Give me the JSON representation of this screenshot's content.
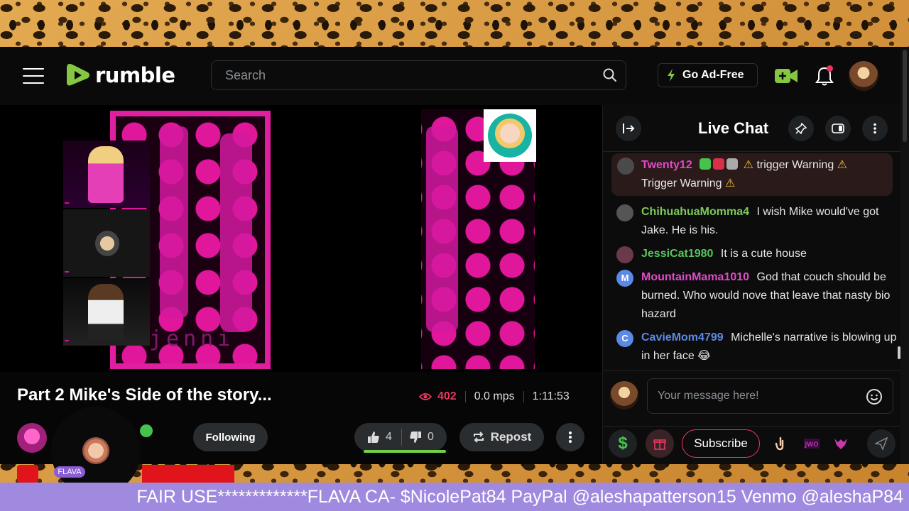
{
  "header": {
    "logo_text": "rumble",
    "search_placeholder": "Search",
    "ad_free_label": "Go Ad-Free"
  },
  "video": {
    "title": "Part 2 Mike's Side of the story...",
    "views": "402",
    "mps": "0.0 mps",
    "duration": "1:11:53",
    "following_label": "Following",
    "likes": "4",
    "dislikes": "0",
    "repost_label": "Repost",
    "watermark": "jenni"
  },
  "chat": {
    "title": "Live Chat",
    "messages": [
      {
        "user": "Twenty12",
        "color": "#e14bc8",
        "text": "trigger Warning",
        "text2": "Trigger Warning",
        "highlight": true
      },
      {
        "user": "ChihuahuaMomma4",
        "color": "#7cc95b",
        "text": "I wish Mike would've got Jake. He is his."
      },
      {
        "user": "JessiCat1980",
        "color": "#55c65a",
        "text": "It is a cute house"
      },
      {
        "user": "MountainMama1010",
        "color": "#e14bc8",
        "initial": "M",
        "text": "God that couch should be burned. Who would nove that leave that nasty bio hazard"
      },
      {
        "user": "CavieMom4799",
        "color": "#5b8ae6",
        "initial": "C",
        "text": "Michelle's narrative is blowing up in her face 😂"
      }
    ],
    "compose_placeholder": "Your message here!",
    "dollar_label": "$",
    "subscribe_label": "Subscribe"
  },
  "overlay": {
    "guest_label": "FLAVA",
    "banner_text": "FAIR USE*************FLAVA CA- $NicolePat84 PayPal @aleshapatterson15 Venmo @aleshaP84"
  },
  "colors": {
    "brand_green": "#85c742",
    "alert_red": "#e8365d",
    "banner_purple": "#a08ae0"
  }
}
